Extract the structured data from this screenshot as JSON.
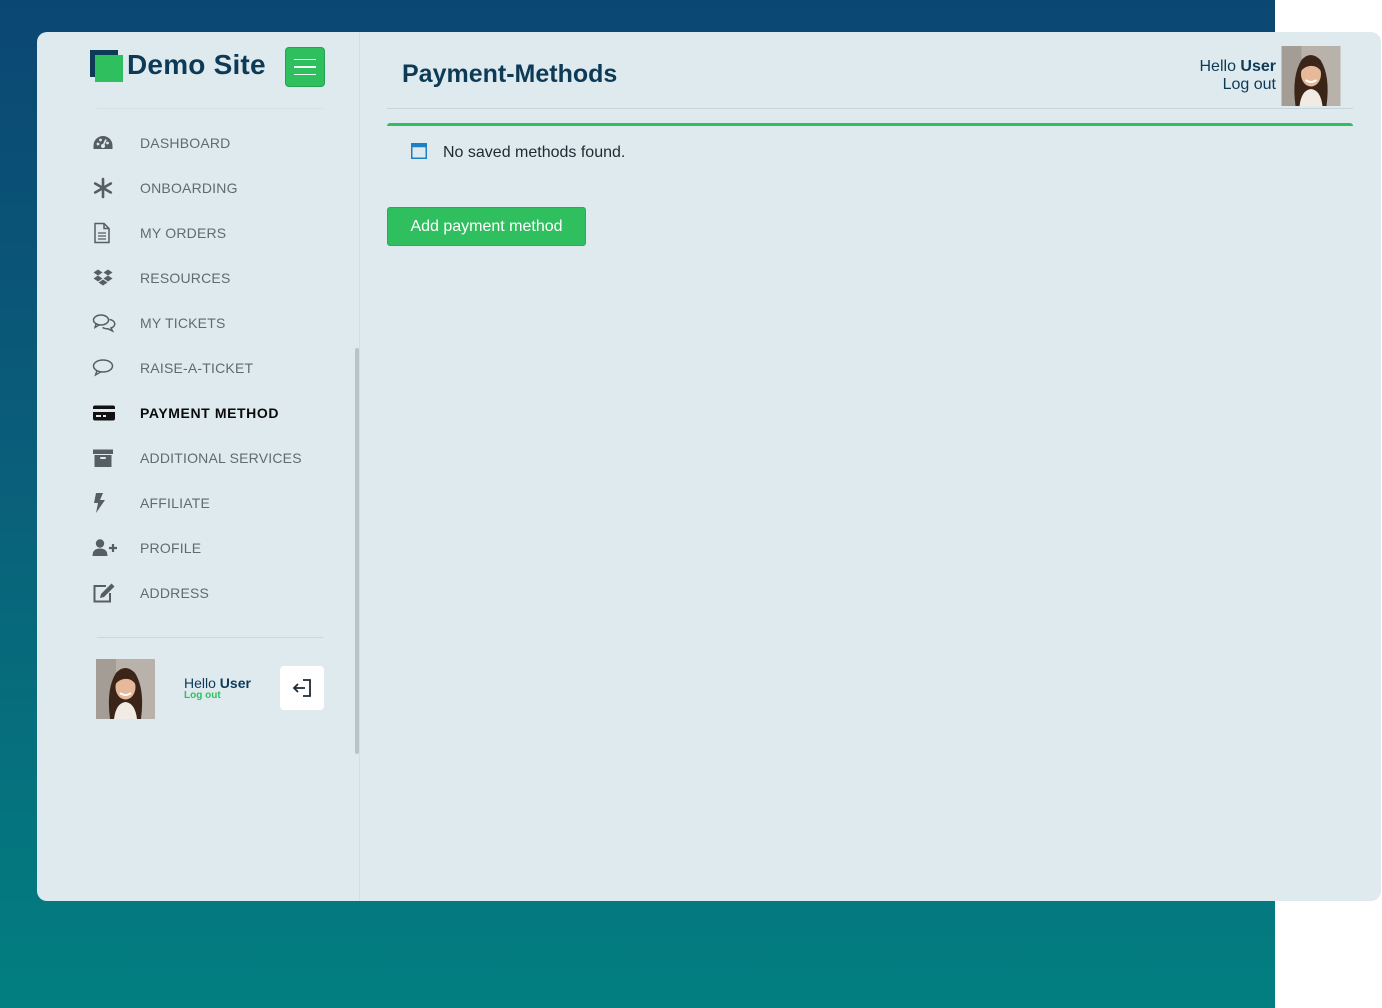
{
  "brand": {
    "name": "Demo Site"
  },
  "sidebar": {
    "items": [
      {
        "label": "DASHBOARD",
        "icon": "dashboard-icon",
        "active": false
      },
      {
        "label": "ONBOARDING",
        "icon": "asterisk-icon",
        "active": false
      },
      {
        "label": "MY ORDERS",
        "icon": "document-icon",
        "active": false
      },
      {
        "label": "RESOURCES",
        "icon": "dropbox-icon",
        "active": false
      },
      {
        "label": "MY TICKETS",
        "icon": "chat-bubbles-icon",
        "active": false
      },
      {
        "label": "RAISE-A-TICKET",
        "icon": "chat-bubble-icon",
        "active": false
      },
      {
        "label": "PAYMENT METHOD",
        "icon": "credit-card-icon",
        "active": true
      },
      {
        "label": "ADDITIONAL SERVICES",
        "icon": "archive-icon",
        "active": false
      },
      {
        "label": "AFFILIATE",
        "icon": "lightning-icon",
        "active": false
      },
      {
        "label": "PROFILE",
        "icon": "user-plus-icon",
        "active": false
      },
      {
        "label": "ADDRESS",
        "icon": "edit-icon",
        "active": false
      }
    ],
    "user": {
      "hello": "Hello",
      "name": "User",
      "logout": "Log out"
    }
  },
  "header": {
    "title": "Payment-Methods",
    "user": {
      "hello": "Hello",
      "name": "User",
      "logout": "Log out"
    }
  },
  "main": {
    "notice": "No saved methods found.",
    "add_button": "Add payment method"
  },
  "colors": {
    "accent": "#2fbf5f",
    "brand_dark": "#0d3a57",
    "card_bg": "#dfeaef",
    "background_top": "#0b4773",
    "background_bottom": "#027f80"
  }
}
